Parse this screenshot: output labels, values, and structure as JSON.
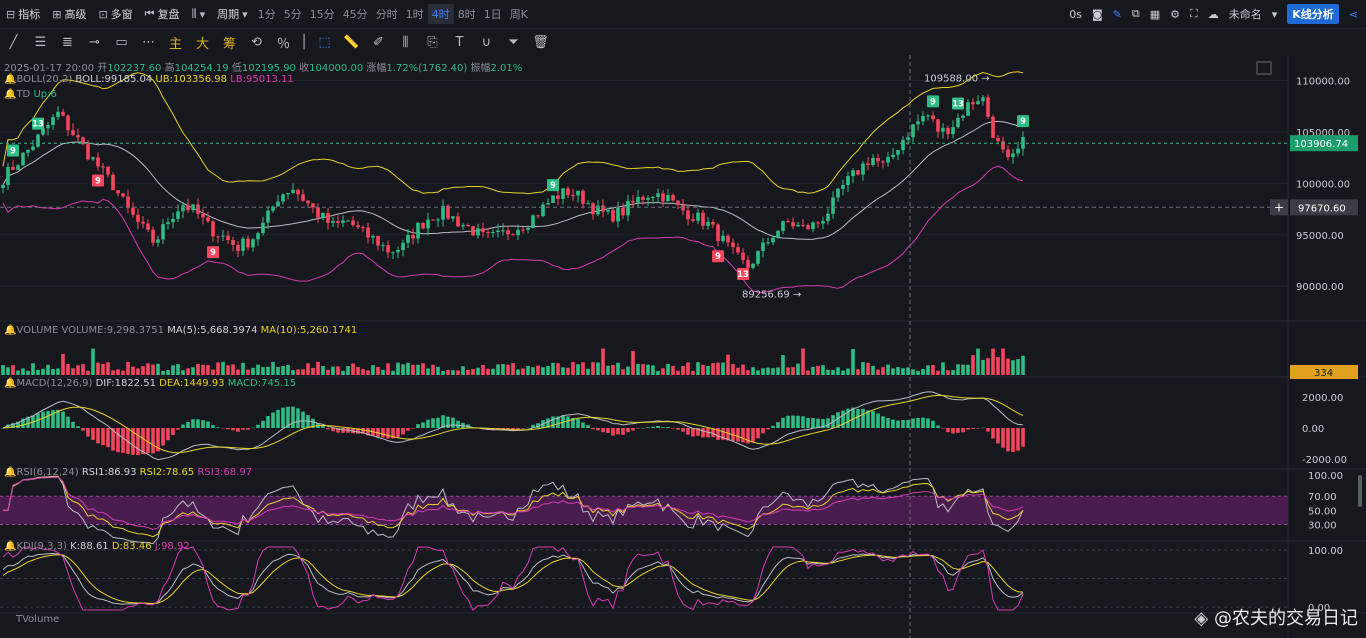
{
  "toolbar": {
    "indicators": "指标",
    "advanced": "高级",
    "multi_window": "多窗",
    "replay": "复盘",
    "period": "周期",
    "intervals": [
      "1分",
      "5分",
      "15分",
      "45分",
      "分时",
      "1时",
      "4时",
      "8时",
      "1日",
      "周K"
    ],
    "active_interval": "4时",
    "countdown": "0s",
    "layout_name": "未命名",
    "k_analysis": "K线分析"
  },
  "drawtools": {
    "main": "主",
    "big": "大",
    "chips": "筹"
  },
  "info": {
    "date": "2025-01-17 20:00",
    "open_label": "开",
    "open": "102237.60",
    "high_label": "高",
    "high": "104254.19",
    "low_label": "低",
    "low": "102195.90",
    "close_label": "收",
    "close": "104000.00",
    "change_label": "涨幅",
    "change": "1.72%(1762.40)",
    "amp_label": "振幅",
    "amp": "2.01%",
    "boll_name": "BOLL(20,2)",
    "boll": "BOLL:99185.04",
    "ub": "UB:103356.98",
    "lb": "LB:95013.11",
    "td_name": "TD",
    "td": "Up:6",
    "vol_name": "VOLUME",
    "vol": "VOLUME:9,298.3751",
    "ma5": "MA(5):5,668.3974",
    "ma10": "MA(10):5,260.1741",
    "macd_name": "MACD(12,26,9)",
    "dif": "DIF:1822.51",
    "dea": "DEA:1449.93",
    "macd": "MACD:745.15",
    "rsi_name": "RSI(6,12,24)",
    "rsi1": "RSI1:86.93",
    "rsi2": "RSI2:78.65",
    "rsi3": "RSI3:68.97",
    "kdj_name": "KDJ(9,3,3)",
    "k": "K:88.61",
    "d": "D:83.46",
    "j": "J:98.92",
    "tvol_name": "TVolume"
  },
  "colors": {
    "up": "#2ebd85",
    "down": "#f6465d",
    "ub": "#e8d22a",
    "lb": "#d63ab5",
    "mid": "#b9bcc4",
    "bg": "#16181d"
  },
  "watermark": "@农夫的交易日记",
  "chart_data": {
    "type": "candlestick",
    "timeframe": "4h",
    "price_axis": {
      "ticks": [
        90000,
        95000,
        100000,
        105000,
        110000
      ],
      "labels": [
        "90000.00",
        "95000.00",
        "100000.00",
        "105000.00",
        "110000.00"
      ]
    },
    "last_price": "103906.74",
    "crosshair_price": "97670.60",
    "high_marker": "109588.00",
    "low_marker": "89256.69",
    "volume_label": "334",
    "macd_ticks": [
      "2000.00",
      "0.00",
      "-2000.00"
    ],
    "rsi_ticks": [
      "100.00",
      "70.00",
      "50.00",
      "30.00"
    ],
    "kdj_ticks": [
      "100.00",
      "0.00"
    ],
    "td_markers": [
      {
        "i": 2,
        "v": "9",
        "side": "up"
      },
      {
        "i": 7,
        "v": "13",
        "side": "up"
      },
      {
        "i": 19,
        "v": "9",
        "side": "down"
      },
      {
        "i": 42,
        "v": "9",
        "side": "down"
      },
      {
        "i": 110,
        "v": "9",
        "side": "up"
      },
      {
        "i": 143,
        "v": "9",
        "side": "down"
      },
      {
        "i": 148,
        "v": "13",
        "side": "down"
      },
      {
        "i": 186,
        "v": "9",
        "side": "up"
      },
      {
        "i": 191,
        "v": "13",
        "side": "up"
      },
      {
        "i": 204,
        "v": "9",
        "side": "up"
      }
    ],
    "close_path": [
      100500,
      102000,
      103500,
      105200,
      106800,
      105000,
      103200,
      101500,
      99800,
      97500,
      95800,
      94200,
      96500,
      98000,
      97200,
      95600,
      94800,
      93800,
      94500,
      96200,
      98800,
      99600,
      98200,
      96800,
      95800,
      96400,
      95200,
      94500,
      93400,
      93800,
      95600,
      96800,
      97200,
      96300,
      95500,
      94600,
      94900,
      95600,
      96200,
      97400,
      98700,
      99200,
      98600,
      97400,
      96800,
      97300,
      98400,
      99100,
      98800,
      97600,
      96900
    ],
    "ohlc_note": "candles generated from close_path keypoints"
  }
}
